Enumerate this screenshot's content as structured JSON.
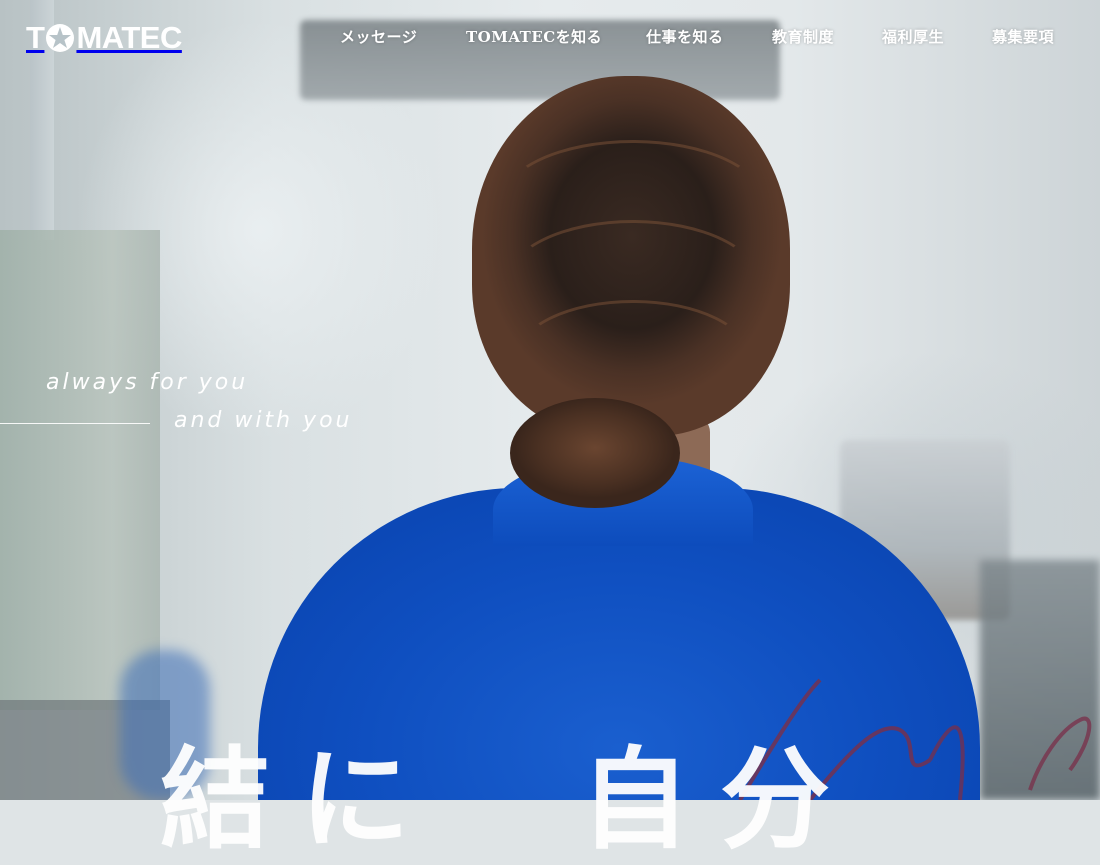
{
  "brand": {
    "logo_text_pre": "T",
    "logo_text_post": "MATEC"
  },
  "nav": {
    "items": [
      {
        "label": "メッセージ"
      },
      {
        "label": "TOMATECを知る"
      },
      {
        "label": "仕事を知る"
      },
      {
        "label": "教育制度"
      },
      {
        "label": "福利厚生"
      },
      {
        "label": "募集要項"
      }
    ]
  },
  "hero": {
    "tagline_line1": "always for you",
    "tagline_line2": "and with you",
    "headline": "結に　自分",
    "script_text": "always"
  },
  "colors": {
    "nav_text": "#ffffff",
    "shirt_blue": "#1a5fcf",
    "script_accent": "#7a2f49"
  }
}
